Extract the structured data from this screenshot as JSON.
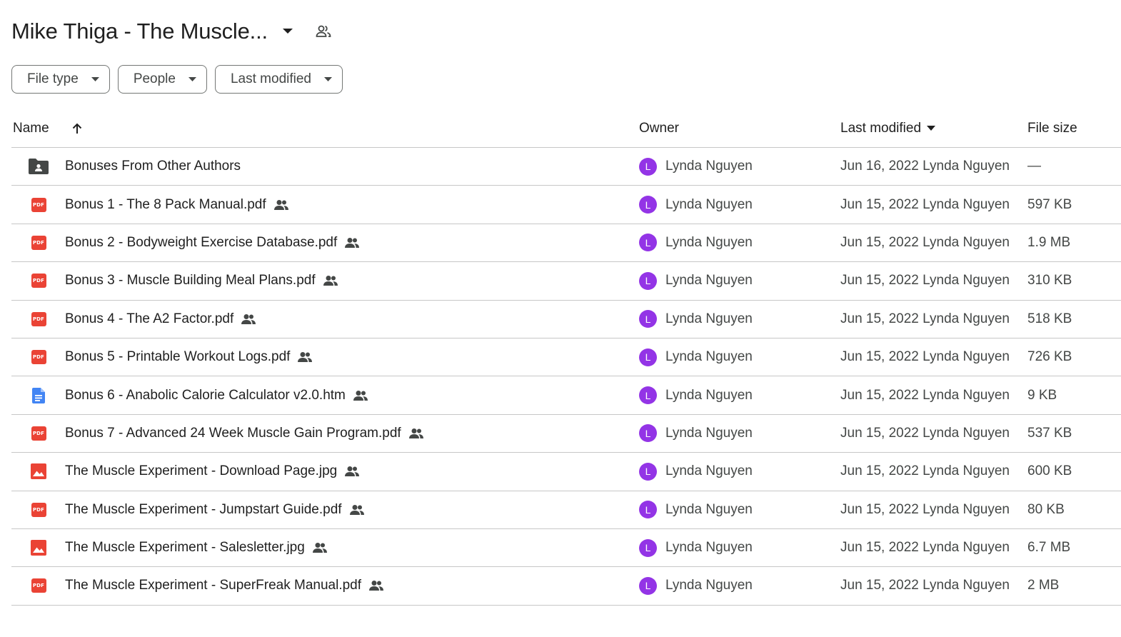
{
  "header": {
    "title": "Mike Thiga - The Muscle..."
  },
  "filters": [
    {
      "label": "File type"
    },
    {
      "label": "People"
    },
    {
      "label": "Last modified"
    }
  ],
  "columns": {
    "name": "Name",
    "owner": "Owner",
    "last_modified": "Last modified",
    "file_size": "File size"
  },
  "colors": {
    "avatar": "#9334e6",
    "pdf": "#ea4335",
    "doc": "#4285f4",
    "image": "#ea4335",
    "folder": "#444746"
  },
  "files": [
    {
      "icon": "shared-folder-icon",
      "name": "Bonuses From Other Authors",
      "shared": false,
      "owner_initial": "L",
      "owner": "Lynda Nguyen",
      "modified": "Jun 16, 2022 Lynda Nguyen",
      "size": "—"
    },
    {
      "icon": "pdf-icon",
      "name": "Bonus 1 - The 8 Pack Manual.pdf",
      "shared": true,
      "owner_initial": "L",
      "owner": "Lynda Nguyen",
      "modified": "Jun 15, 2022 Lynda Nguyen",
      "size": "597 KB"
    },
    {
      "icon": "pdf-icon",
      "name": "Bonus 2 - Bodyweight Exercise Database.pdf",
      "shared": true,
      "owner_initial": "L",
      "owner": "Lynda Nguyen",
      "modified": "Jun 15, 2022 Lynda Nguyen",
      "size": "1.9 MB"
    },
    {
      "icon": "pdf-icon",
      "name": "Bonus 3 - Muscle Building Meal Plans.pdf",
      "shared": true,
      "owner_initial": "L",
      "owner": "Lynda Nguyen",
      "modified": "Jun 15, 2022 Lynda Nguyen",
      "size": "310 KB"
    },
    {
      "icon": "pdf-icon",
      "name": "Bonus 4 - The A2 Factor.pdf",
      "shared": true,
      "owner_initial": "L",
      "owner": "Lynda Nguyen",
      "modified": "Jun 15, 2022 Lynda Nguyen",
      "size": "518 KB"
    },
    {
      "icon": "pdf-icon",
      "name": "Bonus 5 - Printable Workout Logs.pdf",
      "shared": true,
      "owner_initial": "L",
      "owner": "Lynda Nguyen",
      "modified": "Jun 15, 2022 Lynda Nguyen",
      "size": "726 KB"
    },
    {
      "icon": "doc-icon",
      "name": "Bonus 6 - Anabolic Calorie Calculator v2.0.htm",
      "shared": true,
      "owner_initial": "L",
      "owner": "Lynda Nguyen",
      "modified": "Jun 15, 2022 Lynda Nguyen",
      "size": "9 KB"
    },
    {
      "icon": "pdf-icon",
      "name": "Bonus 7 - Advanced 24 Week Muscle Gain Program.pdf",
      "shared": true,
      "owner_initial": "L",
      "owner": "Lynda Nguyen",
      "modified": "Jun 15, 2022 Lynda Nguyen",
      "size": "537 KB"
    },
    {
      "icon": "image-icon",
      "name": "The Muscle Experiment - Download Page.jpg",
      "shared": true,
      "owner_initial": "L",
      "owner": "Lynda Nguyen",
      "modified": "Jun 15, 2022 Lynda Nguyen",
      "size": "600 KB"
    },
    {
      "icon": "pdf-icon",
      "name": "The Muscle Experiment - Jumpstart Guide.pdf",
      "shared": true,
      "owner_initial": "L",
      "owner": "Lynda Nguyen",
      "modified": "Jun 15, 2022 Lynda Nguyen",
      "size": "80 KB"
    },
    {
      "icon": "image-icon",
      "name": "The Muscle Experiment - Salesletter.jpg",
      "shared": true,
      "owner_initial": "L",
      "owner": "Lynda Nguyen",
      "modified": "Jun 15, 2022 Lynda Nguyen",
      "size": "6.7 MB"
    },
    {
      "icon": "pdf-icon",
      "name": "The Muscle Experiment - SuperFreak Manual.pdf",
      "shared": true,
      "owner_initial": "L",
      "owner": "Lynda Nguyen",
      "modified": "Jun 15, 2022 Lynda Nguyen",
      "size": "2 MB"
    }
  ]
}
